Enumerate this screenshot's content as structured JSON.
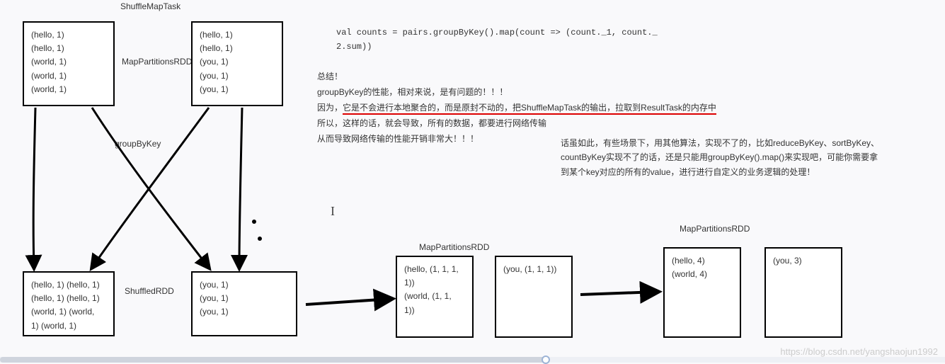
{
  "labels": {
    "shuffleMapTask": "ShuffleMapTask",
    "mapPartitionsRDD_top": "MapPartitionsRDD",
    "groupByKey": "groupByKey",
    "shuffledRDD": "ShuffledRDD",
    "mapPartitionsRDD_mid": "MapPartitionsRDD",
    "mapPartitionsRDD_right": "MapPartitionsRDD"
  },
  "boxes": {
    "topLeft": "(hello, 1)\n(hello, 1)\n(world, 1)\n(world, 1)\n(world, 1)",
    "topRight": "(hello, 1)\n(hello, 1)\n(you, 1)\n(you, 1)\n(you, 1)",
    "bottomLeft": "(hello, 1) (hello, 1)\n(hello, 1) (hello, 1)\n(world, 1) (world,\n1) (world, 1)",
    "bottomMid": "(you, 1)\n(you, 1)\n(you, 1)",
    "midGroup1": "(hello, (1, 1, 1,\n1))\n(world, (1, 1,\n1))",
    "midGroup2": "(you, (1, 1, 1))",
    "resultLeft": "(hello, 4)\n(world, 4)",
    "resultRight": "(you, 3)"
  },
  "code": {
    "line1": "val counts = pairs.groupByKey().map(count => (count._1, count._",
    "line2": "2.sum))"
  },
  "text": {
    "summary": "总结！",
    "p1": "groupByKey的性能，相对来说，是有问题的！！！",
    "p2a": "因为，",
    "p2b": "它是不会进行本地聚合的，而是原封不动的，把ShuffleMapTask的输出，拉取到ResultTask的内存中",
    "p3": "所以，这样的话，就会导致，所有的数据，都要进行网络传输",
    "p4": "从而导致网络传输的性能开销非常大！！！",
    "sideP1": "话虽如此，有些场景下，用其他算法，实现不了的，比如reduceByKey、sortByKey、",
    "sideP2": "countByKey实现不了的话，还是只能用groupByKey().map()来实现吧，可能你需要拿",
    "sideP3": "到某个key对应的所有的value，进行进行自定义的业务逻辑的处理！"
  },
  "watermark": "https://blog.csdn.net/yangshaojun1992"
}
